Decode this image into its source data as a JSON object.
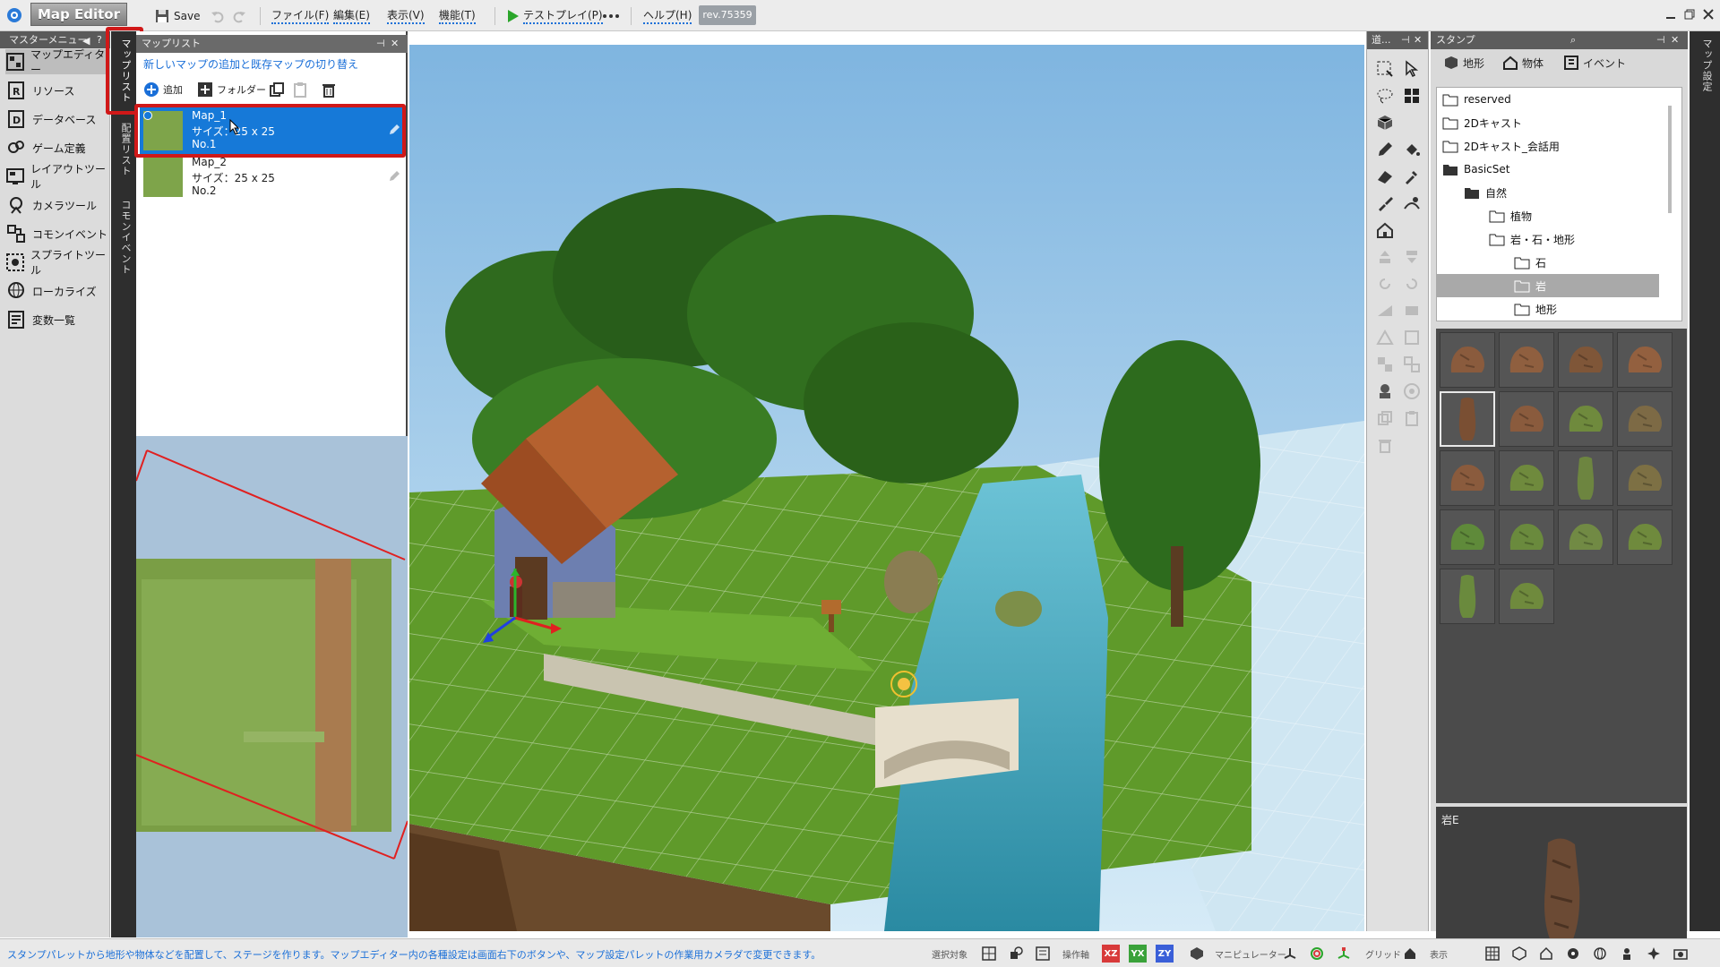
{
  "app": {
    "title": "Map Editor",
    "save_label": "Save",
    "rev": "rev.75359"
  },
  "menu": [
    {
      "label": "ファイル(F)"
    },
    {
      "label": "編集(E)"
    },
    {
      "label": "表示(V)"
    },
    {
      "label": "機能(T)"
    },
    {
      "label": "テストプレイ(P)"
    },
    {
      "label": "ヘルプ(H)"
    }
  ],
  "master_menu": {
    "title": "マスターメニュー",
    "items": [
      {
        "label": "マップエディター",
        "icon": "map-editor-icon"
      },
      {
        "label": "リソース",
        "icon": "resource-icon"
      },
      {
        "label": "データベース",
        "icon": "database-icon"
      },
      {
        "label": "ゲーム定義",
        "icon": "game-definition-icon"
      },
      {
        "label": "レイアウトツール",
        "icon": "layout-tool-icon"
      },
      {
        "label": "カメラツール",
        "icon": "camera-tool-icon"
      },
      {
        "label": "コモンイベント",
        "icon": "common-event-icon"
      },
      {
        "label": "スプライトツール",
        "icon": "sprite-tool-icon"
      },
      {
        "label": "ローカライズ",
        "icon": "localize-icon"
      },
      {
        "label": "変数一覧",
        "icon": "variables-icon"
      }
    ]
  },
  "side_tabs": [
    "マップリスト",
    "配置リスト",
    "コモンイベント"
  ],
  "map_list": {
    "title": "マップリスト",
    "hint": "新しいマップの追加と既存マップの切り替え",
    "add_label": "追加",
    "folder_label": "フォルダー",
    "maps": [
      {
        "name": "Map_1",
        "size": "サイズ：25 x 25",
        "no": "No.1"
      },
      {
        "name": "Map_2",
        "size": "サイズ：25 x 25",
        "no": "No.2"
      }
    ]
  },
  "tools_panel": {
    "title": "道..."
  },
  "stamp": {
    "title": "スタンプ",
    "tabs": [
      "地形",
      "物体",
      "イベント"
    ],
    "tree": [
      {
        "label": "reserved"
      },
      {
        "label": "2Dキャスト"
      },
      {
        "label": "2Dキャスト_会話用"
      },
      {
        "label": "BasicSet"
      },
      {
        "label": "自然"
      },
      {
        "label": "植物"
      },
      {
        "label": "岩・石・地形"
      },
      {
        "label": "石"
      },
      {
        "label": "岩"
      },
      {
        "label": "地形"
      }
    ],
    "preview_name": "岩E"
  },
  "right_strip": {
    "label": "マップ設定"
  },
  "status": {
    "text": "スタンプパレットから地形や物体などを配置して、ステージを作ります。マップエディター内の各種設定は画面右下のボタンや、マップ設定パレットの作業用カメラダで変更できます。",
    "labels": [
      "選択対象",
      "操作軸",
      "マニピュレーター",
      "グリッド",
      "表示"
    ],
    "axes": [
      "XZ",
      "YX",
      "ZY"
    ]
  },
  "colors": {
    "accent": "#1679d8",
    "highlight": "#d01818",
    "axis_xz": "#d83a3a",
    "axis_yx": "#3aa23a",
    "axis_zy": "#3a5fd8"
  }
}
